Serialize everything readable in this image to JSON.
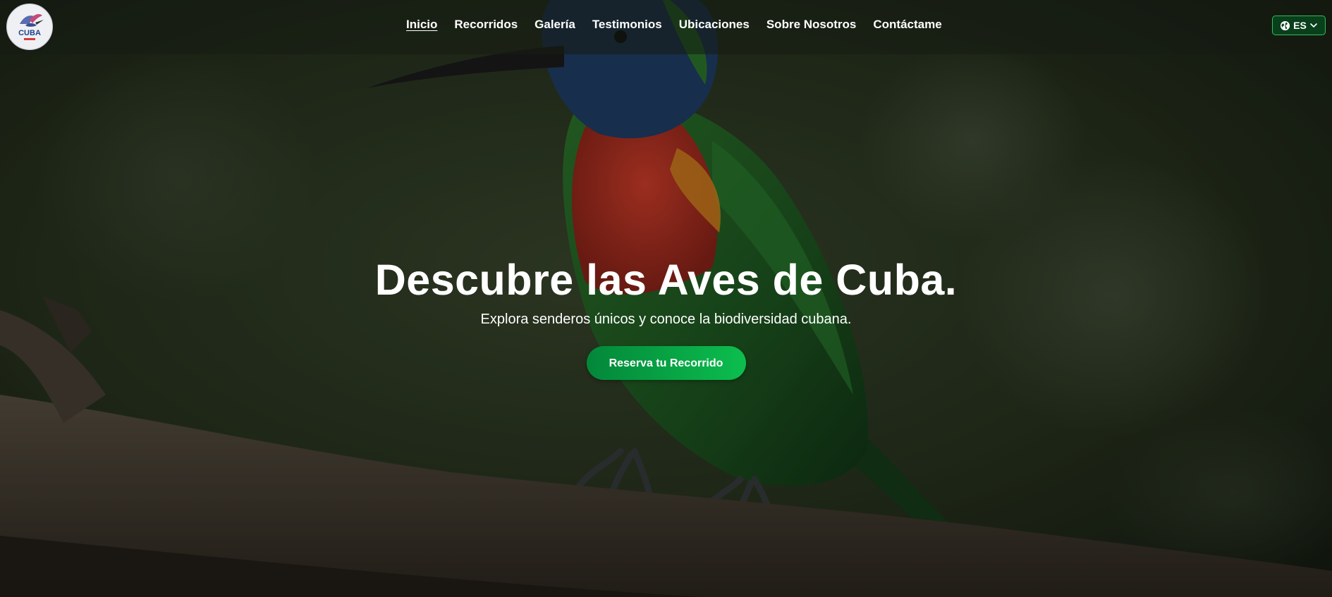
{
  "brand": {
    "logo_text": "CUBA",
    "logo_icon": "hummingbird-logo-icon"
  },
  "nav": {
    "items": [
      {
        "label": "Inicio",
        "active": true
      },
      {
        "label": "Recorridos",
        "active": false
      },
      {
        "label": "Galería",
        "active": false
      },
      {
        "label": "Testimonios",
        "active": false
      },
      {
        "label": "Ubicaciones",
        "active": false
      },
      {
        "label": "Sobre Nosotros",
        "active": false
      },
      {
        "label": "Contáctame",
        "active": false
      }
    ]
  },
  "language": {
    "selected": "ES",
    "icon": "globe-icon",
    "dropdown_icon": "chevron-down-icon"
  },
  "hero": {
    "title": "Descubre las Aves de Cuba.",
    "subtitle": "Explora senderos únicos y conoce la biodiversidad cubana.",
    "cta_label": "Reserva tu Recorrido",
    "image": "bird-on-branch-photo"
  },
  "colors": {
    "accent": "#0cbe4e",
    "accent_dark": "#03873a",
    "header_bg": "#161c12"
  }
}
